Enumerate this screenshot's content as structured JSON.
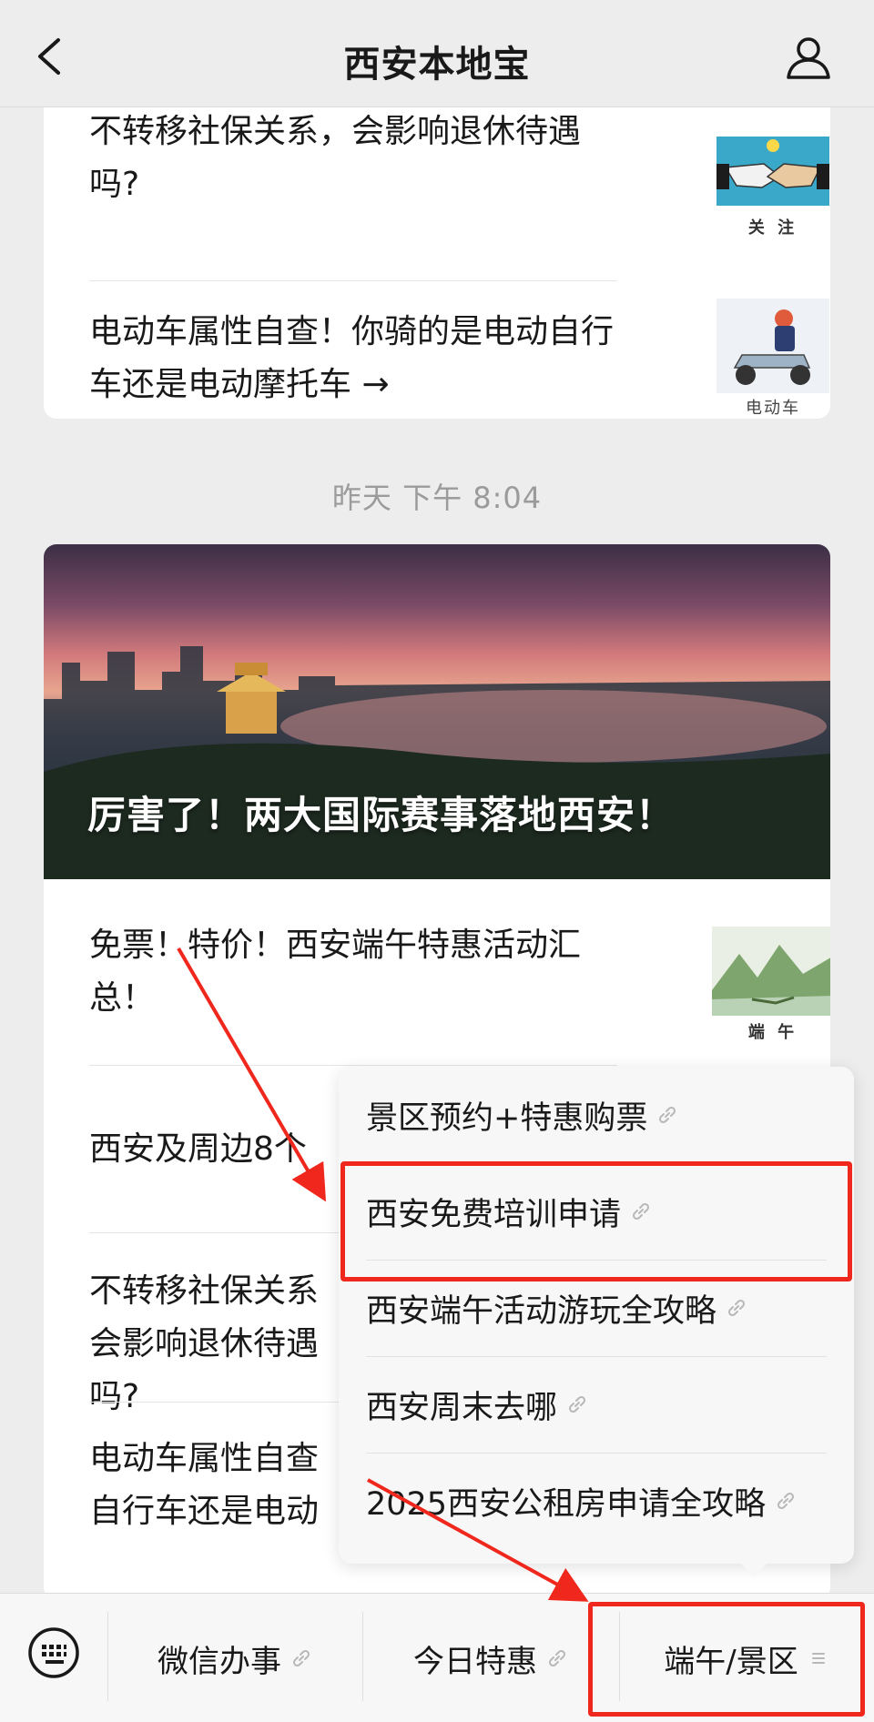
{
  "header": {
    "title": "西安本地宝"
  },
  "feed": {
    "card1": {
      "items": [
        {
          "text": "不转移社保关系，会影响退休待遇吗?",
          "thumb_caption": "关 注",
          "thumb_icon": "handshake-icon"
        },
        {
          "text": "电动车属性自查！你骑的是电动自行车还是电动摩托车 →",
          "thumb_caption": "电动车",
          "thumb_icon": "scooter-icon"
        }
      ]
    },
    "timestamp": "昨天 下午 8:04",
    "card2": {
      "hero_title": "厉害了！两大国际赛事落地西安！",
      "items": [
        {
          "text": "免票！特价！西安端午特惠活动汇总！",
          "thumb_caption": "端 午",
          "thumb_icon": "dragon-boat-icon"
        },
        {
          "text": "西安及周边8个"
        },
        {
          "text": "不转移社保关系会影响退休待遇吗?"
        },
        {
          "text": "电动车属性自查自行车还是电动"
        }
      ]
    }
  },
  "popup_menu": {
    "items": [
      {
        "label": "景区预约+特惠购票",
        "icon": "link-icon"
      },
      {
        "label": "西安免费培训申请",
        "icon": "link-icon"
      },
      {
        "label": "西安端午活动游玩全攻略",
        "icon": "link-icon"
      },
      {
        "label": "西安周末去哪",
        "icon": "link-icon"
      },
      {
        "label": "2025西安公租房申请全攻略",
        "icon": "link-icon"
      }
    ]
  },
  "bottom_menu": {
    "keyboard_icon": "keyboard-icon",
    "buttons": [
      {
        "label": "微信办事",
        "icon": "link-icon"
      },
      {
        "label": "今日特惠",
        "icon": "link-icon"
      },
      {
        "label": "端午/景区",
        "icon": "menu-lines-icon"
      }
    ]
  },
  "colors": {
    "background": "#ededed",
    "card": "#ffffff",
    "popup": "#f7f7f7",
    "annotation_red": "#f0271c",
    "timestamp_text": "#9b9b9b"
  }
}
